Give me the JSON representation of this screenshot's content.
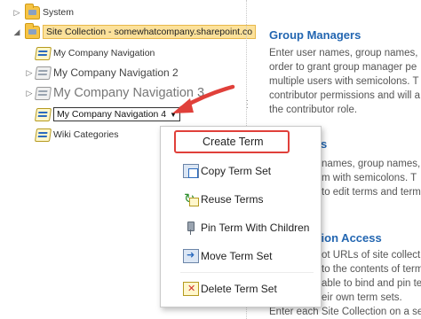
{
  "tree": {
    "system_label": "System",
    "site_collection_label": "Site Collection - somewhatcompany.sharepoint.co",
    "items": [
      {
        "label": "My Company Navigation"
      },
      {
        "label": "My Company Navigation 2"
      },
      {
        "label": "My Company Navigation 3"
      },
      {
        "label": "My Company Navigation 4"
      },
      {
        "label": "Wiki Categories"
      }
    ]
  },
  "context_menu": {
    "items": [
      {
        "label": "Create Term",
        "icon": "none"
      },
      {
        "label": "Copy Term Set",
        "icon": "copy-icon"
      },
      {
        "label": "Reuse Terms",
        "icon": "reuse-icon"
      },
      {
        "label": "Pin Term With Children",
        "icon": "pin-icon"
      },
      {
        "label": "Move Term Set",
        "icon": "move-icon"
      },
      {
        "label": "Delete Term Set",
        "icon": "delete-icon"
      }
    ]
  },
  "properties": {
    "group_managers": {
      "heading": "Group Managers",
      "lines": [
        "Enter user names, group names, o",
        "order to grant group manager pe",
        "multiple users with semicolons. T",
        "contributor permissions and will a",
        "the contributor role."
      ]
    },
    "contributors": {
      "heading": "ors",
      "lines": [
        "names, group names, o",
        "m with semicolons. T",
        "to edit terms and terms"
      ]
    },
    "site_collection_access": {
      "heading": "ation Access",
      "lines": [
        "ot URLs of site collecti",
        "to the contents of term",
        "able to bind and pin ter",
        "eir own term sets.",
        "Enter each Site Collection on a sepa"
      ]
    }
  },
  "colors": {
    "heading_blue": "#2366b1",
    "highlight_red": "#e0403a",
    "site_collection_bg": "#fce19a"
  }
}
